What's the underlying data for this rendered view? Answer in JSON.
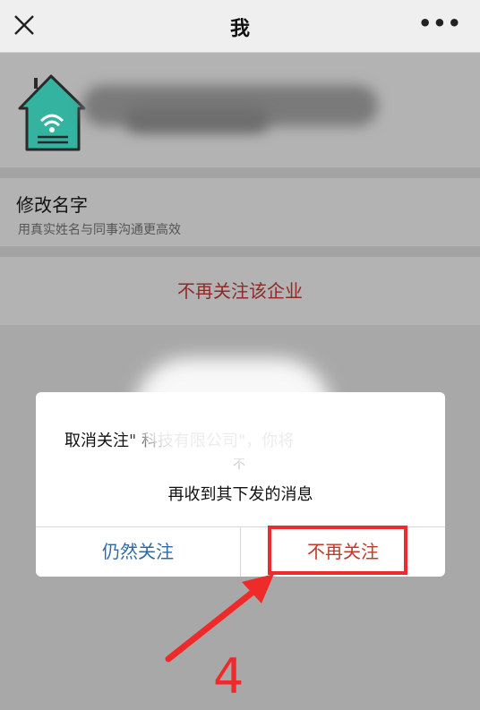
{
  "nav": {
    "title": "我",
    "more_label": "•••",
    "close_icon": "close-icon"
  },
  "profile": {
    "avatar_icon": "house-wifi-icon"
  },
  "rename": {
    "title": "修改名字",
    "subtitle": "用真实姓名与同事沟通更高效"
  },
  "unfollow_row": {
    "label": "不再关注该企业"
  },
  "dialog": {
    "message_line1": "取消关注\"                         科技有限公司\"，你将",
    "message_fragment": "不",
    "message_line2": "再收到其下发的消息",
    "cancel_label": "仍然关注",
    "confirm_label": "不再关注"
  },
  "annotation": {
    "step_number": "4",
    "color": "#ee2a2a"
  },
  "colors": {
    "overlay": "#a8a8a8",
    "danger_text": "#c0392b",
    "link_text": "#2f6aa8"
  }
}
